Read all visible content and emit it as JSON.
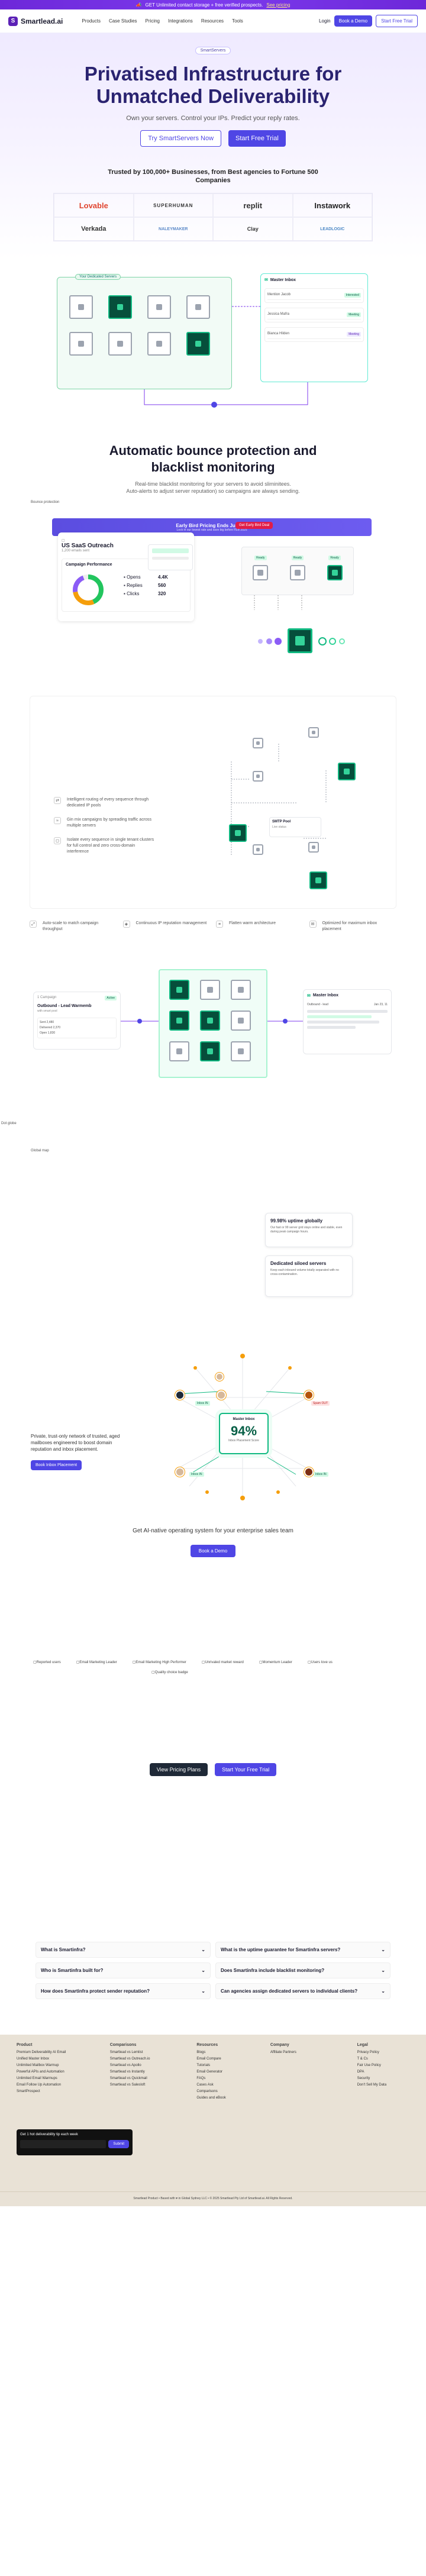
{
  "announce": {
    "text": "GET Unlimited contact storage + free verified prospects.",
    "link": "See pricing"
  },
  "nav": {
    "brand": "Smartlead.ai",
    "links": [
      "Products",
      "Case Studies",
      "Pricing",
      "Integrations",
      "Resources",
      "Tools"
    ],
    "login": "Login",
    "demo": "Book a Demo",
    "trial": "Start Free Trial"
  },
  "hero": {
    "pill": "SmartServers",
    "title_line1": "Privatised Infrastructure for",
    "title_line2": "Unmatched Deliverability",
    "subtitle": "Own your servers. Control your IPs. Predict your reply rates.",
    "cta1": "Try SmartServers Now",
    "cta2": "Start Free Trial"
  },
  "trusted": {
    "line1": "Trusted by 100,000+ Businesses, from Best agencies to Fortune 500",
    "line2": "Companies"
  },
  "logos": [
    "Lovable",
    "SUPERHUMAN",
    "replit",
    "Instawork",
    "Verkada",
    "NALEYMAKER",
    "Clay",
    "LEADLOGIC"
  ],
  "diagram1": {
    "left_label": "Your Dedicated Servers",
    "mailbox_title": "Master Inbox",
    "rows": [
      {
        "text": "Mention Jacob",
        "tag": "Interested"
      },
      {
        "text": "Jessica Mafra",
        "tag": "Meeting"
      },
      {
        "text": "Bianca Hilden",
        "tag": "Meeting"
      }
    ]
  },
  "sec2": {
    "title_line1": "Automatic bounce protection and",
    "title_line2": "blacklist monitoring",
    "body_line1": "Real-time blacklist monitoring for your servers to avoid sliminitees.",
    "body_line2": "Auto-alerts to adjust server reputation) so campaigns are always sending."
  },
  "sec2_diag": {
    "alt": "Bounce protection",
    "banner": "Early Bird Pricing Ends July 5th",
    "banner_sub": "Lock in our lowest rate and save big before FEB 2025",
    "banner_btn": "Get Early Bird Deal",
    "campaign_name": "US SaaS Outreach",
    "campaign_sub": "1,200 emails sent",
    "perf_title": "Campaign Performance",
    "opens_label": "Opens",
    "opens": "4.4K",
    "replies_label": "Replies",
    "replies": "560",
    "clicks_label": "Clicks",
    "clicks": "320",
    "chips": [
      "Ready",
      "Ready",
      "Ready"
    ]
  },
  "sec3": {
    "features": [
      "Intelligent routing of every sequence through dedicated IP pools",
      "Gin mix campaigns by spreading traffic across multiple servers",
      "Isolate every sequence in single tenant clusters for full control and zero cross-domain interference"
    ],
    "server_card_title": "SMTP Pool",
    "server_card_sub": "Live status",
    "icons": [
      "Auto-scale to match campaign throughput",
      "Continuous IP reputation management",
      "Flatten warm architecture",
      "Optimized for maximum inbox placement"
    ]
  },
  "sec4": {
    "campaign_label": "1 Campaign",
    "campaign_status": "Active",
    "campaign_name": "Outbound - Lead Warmemb",
    "campaign_sub": "with smart pool",
    "stats": [
      "Sent 2,480",
      "Delivered 2,370",
      "Open 1,830"
    ],
    "mailbox_title": "Master Inbox",
    "mailbox_row": "Outbound - lead",
    "mailbox_date": "Jan 23, 11"
  },
  "sec5": {
    "img1_alt": "Dot globe",
    "img2_alt": "Global map",
    "card1_title": "99.98% uptime globally",
    "card1_body": "Our fast or 99 server grid stays online and stable, even during peak campaign hours.",
    "card2_title": "Dedicated siloed servers",
    "card2_body": "Keep each inbound volume totally separated with no cross-contamination."
  },
  "sec6": {
    "body": "Private, trust-only network of trusted, aged mailboxes engineered to boost domain reputation and inbox placement.",
    "button": "Book Inbox Placement",
    "hub_title": "Master Inbox",
    "hub_value": "94%",
    "hub_sub": "Inbox Placement Score",
    "tags": [
      "Inbox IN",
      "Spam OUT",
      "Inbox IN",
      "Inbox IN"
    ]
  },
  "sec7": {
    "text": "Get AI-native operating system for your enterprise sales team",
    "button": "Book a Demo"
  },
  "badges": [
    "Reported users",
    "Email Marketing Leader",
    "Email Marketing High Performer",
    "Unrivaled market reward",
    "Momentum Leader",
    "Users love us",
    "Quality choice badge"
  ],
  "cta2": {
    "pricing": "View Pricing Plans",
    "trial": "Start Your Free Trial"
  },
  "faq": [
    "What is Smartinfra?",
    "What is the uptime guarantee for Smartinfra servers?",
    "Who is Smartinfra built for?",
    "Does Smartinfra include blacklist monitoring?",
    "How does Smartinfra protect sender reputation?",
    "Can agencies assign dedicated servers to individual clients?"
  ],
  "footer": {
    "cols": [
      {
        "title": "Product",
        "items": [
          "Premium Deliverability AI Email",
          "Unified Master Inbox",
          "Unlimited Mailbox Warmup",
          "Powerful APIs and Automation",
          "Unlimited Email Warmups",
          "Email Follow Up Automation",
          "SmartProspect"
        ]
      },
      {
        "title": "Comparisons",
        "items": [
          "Smartlead vs Lemlist",
          "Smartlead vs Outreach.io",
          "Smartlead vs Apollo",
          "Smartlead vs Instantly",
          "Smartlead vs Quickmail",
          "Smartlead vs Salesloft"
        ]
      },
      {
        "title": "Resources",
        "items": [
          "Blogs",
          "Email Compare",
          "Tutorials",
          "Email Generator",
          "FAQs",
          "Cases Ask",
          "Comparisons",
          "Guides and eBook"
        ]
      },
      {
        "title": "Company",
        "items": [
          "Affiliate Partners"
        ]
      },
      {
        "title": "Legal",
        "items": [
          "Privacy Policy",
          "T & Cs",
          "Fair Use Policy",
          "DPA",
          "Security",
          "Don't Sell My Data"
        ]
      }
    ],
    "subscribe_text": "Get 1 hot deliverability tip each week",
    "subscribe_btn": "Submit",
    "bottom": "Smartlead Product  •  Based with ♥ in Global Sydney LLC  •  © 2025 Smartlead Pty Ltd of Smartlead.ai. All Rights Reserved."
  },
  "colors": {
    "brand": "#4f46e5",
    "accent": "#10b981",
    "hero_title": "#2a2370"
  }
}
